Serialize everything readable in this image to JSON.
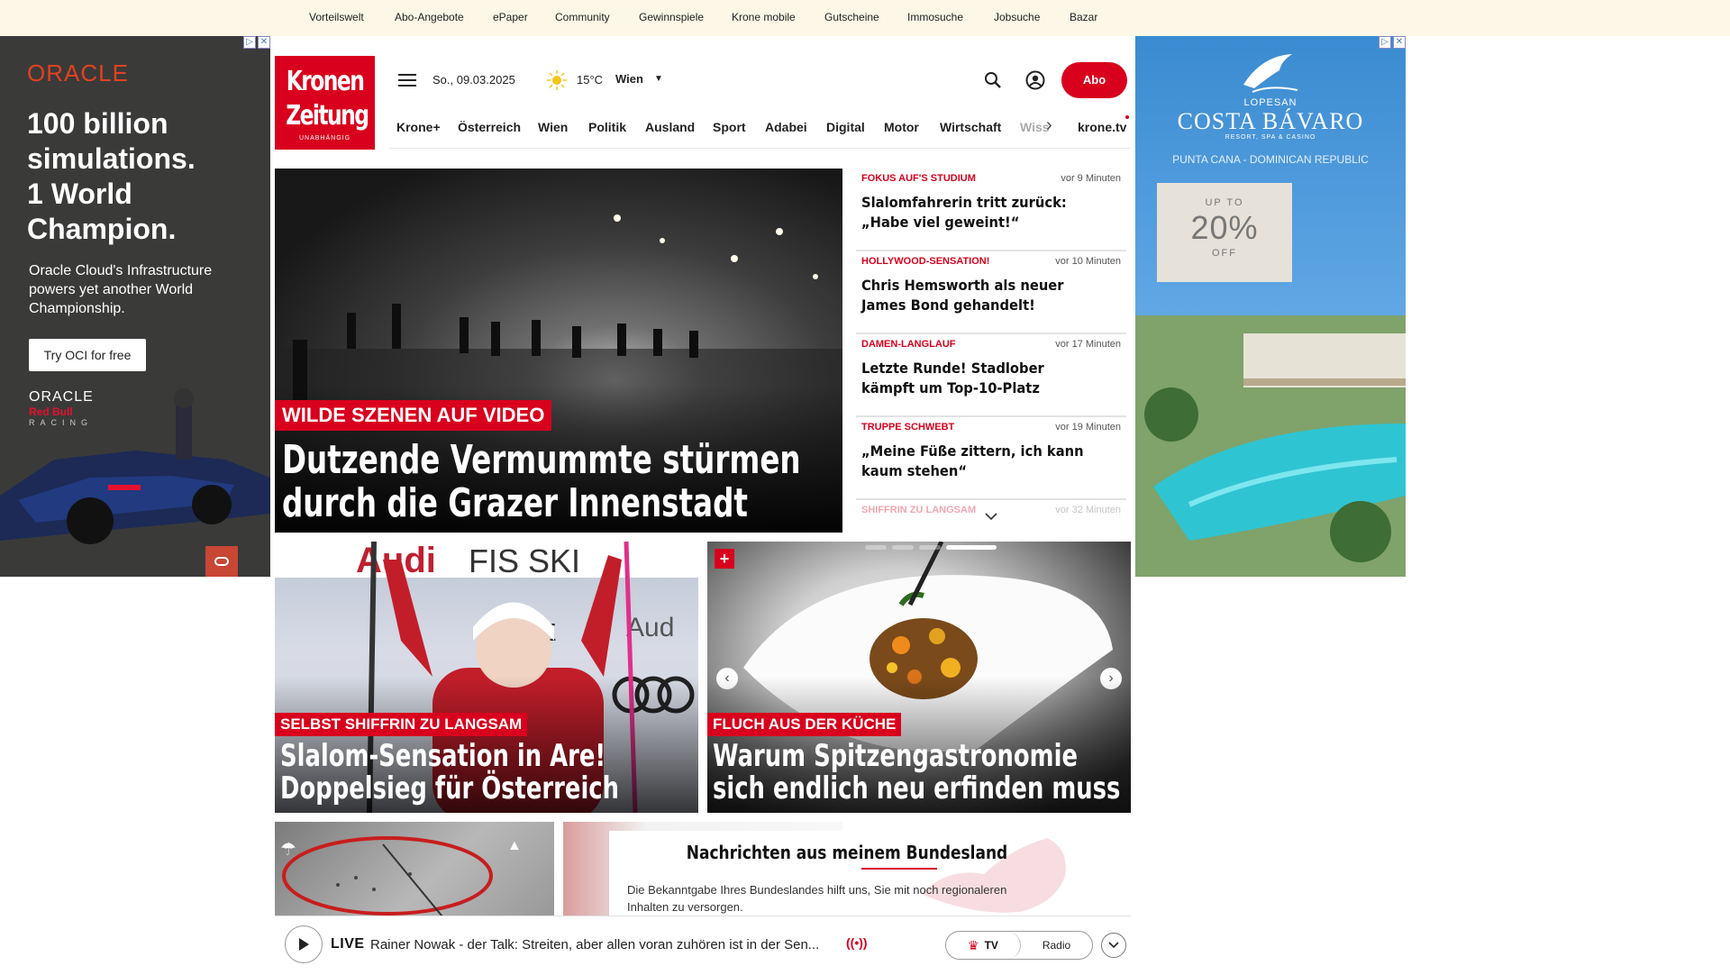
{
  "topnav": [
    "Vorteilswelt",
    "Abo-Angebote",
    "ePaper",
    "Community",
    "Gewinnspiele",
    "Krone mobile",
    "Gutscheine",
    "Immosuche",
    "Jobsuche",
    "Bazar"
  ],
  "ad_left": {
    "brand": "ORACLE",
    "headline_lines": [
      "100 billion",
      "simulations.",
      "1 World",
      "Champion."
    ],
    "body": "Oracle Cloud's Infrastructure powers yet another World Championship.",
    "cta": "Try OCI for free",
    "logo_line1": "ORACLE",
    "logo_line2": "Red Bull",
    "logo_line3": "RACING"
  },
  "ad_right": {
    "brand_small": "LOPESAN",
    "brand": "COSTA BÁVARO",
    "brand_sub": "RESORT, SPA & CASINO",
    "location": "PUNTA CANA - DOMINICAN REPUBLIC",
    "offer_top": "UP TO",
    "offer_value": "20%",
    "offer_bottom": "OFF"
  },
  "logo": {
    "line1": "Kronen",
    "line2": "Zeitung",
    "line3": "UNABHÄNGIG"
  },
  "header": {
    "date": "So., 09.03.2025",
    "temperature": "15°C",
    "city": "Wien",
    "subscribe": "Abo"
  },
  "nav": [
    "Krone+",
    "Österreich",
    "Wien",
    "Politik",
    "Ausland",
    "Sport",
    "Adabei",
    "Digital",
    "Motor",
    "Wirtschaft",
    "Wiss",
    "krone.tv"
  ],
  "hero": {
    "kicker": "WILDE SZENEN AUF VIDEO",
    "title_line1": "Dutzende Vermummte stürmen",
    "title_line2": "durch die Grazer Innenstadt"
  },
  "ticker": [
    {
      "kicker": "FOKUS AUF'S STUDIUM",
      "time": "vor 9 Minuten",
      "title": "Slalomfahrerin tritt zurück: „Habe viel geweint!“"
    },
    {
      "kicker": "HOLLYWOOD-SENSATION!",
      "time": "vor 10 Minuten",
      "title": "Chris Hemsworth als neuer James Bond gehandelt!"
    },
    {
      "kicker": "DAMEN-LANGLAUF",
      "time": "vor 17 Minuten",
      "title": "Letzte Runde! Stadlober kämpft um Top-10-Platz"
    },
    {
      "kicker": "TRUPPE SCHWEBT",
      "time": "vor 19 Minuten",
      "title": "„Meine Füße zittern, ich kann kaum stehen“"
    },
    {
      "kicker": "SHIFFRIN ZU LANGSAM",
      "time": "vor 32 Minuten"
    }
  ],
  "card_left": {
    "kicker": "SELBST SHIFFRIN ZU LANGSAM",
    "title_line1": "Slalom-Sensation in Are!",
    "title_line2": "Doppelsieg für Österreich"
  },
  "card_right": {
    "kicker": "FLUCH AUS DER KÜCHE",
    "title_line1": "Warum Spitzengastronomie",
    "title_line2": "sich endlich neu erfinden muss"
  },
  "bundesland": {
    "title": "Nachrichten aus meinem Bundesland",
    "text": "Die Bekanntgabe Ihres Bundeslandes hilft uns, Sie mit noch regionaleren Inhalten zu versorgen."
  },
  "live": {
    "badge": "LIVE",
    "text": "Rainer Nowak - der Talk: Streiten, aber allen voran zuhören ist in der Sen...",
    "tv": "TV",
    "radio": "Radio"
  },
  "colors": {
    "brand_red": "#d8001d",
    "topbar_bg": "#fcf7e6"
  }
}
